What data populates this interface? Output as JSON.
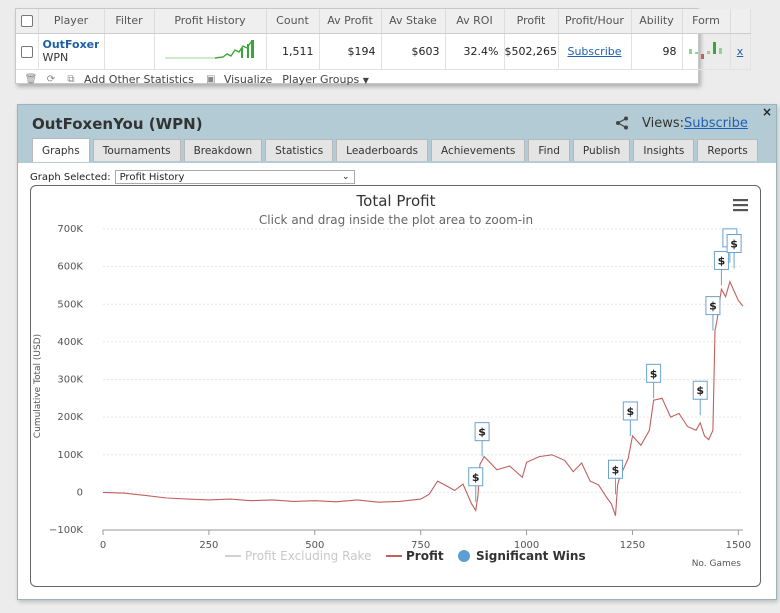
{
  "stats_table": {
    "headers": [
      "Player",
      "Filter",
      "Profit History",
      "Count",
      "Av Profit",
      "Av Stake",
      "Av ROI",
      "Profit",
      "Profit/Hour",
      "Ability",
      "Form"
    ],
    "row": {
      "player_name": "OutFoxenYou",
      "player_network": "WPN",
      "count": "1,511",
      "av_profit": "$194",
      "av_stake": "$603",
      "av_roi": "32.4%",
      "profit": "$502,265",
      "profit_hour": "Subscribe",
      "ability": "98",
      "remove": "x"
    },
    "spark_color": "#3aa63a",
    "toolbar": {
      "add_stats": "Add Other Statistics",
      "visualize": "Visualize",
      "player_groups": "Player Groups"
    }
  },
  "panel": {
    "title": "OutFoxenYou (WPN)",
    "views_label": "Views:",
    "views_link": "Subscribe",
    "close": "×",
    "tabs": [
      "Graphs",
      "Tournaments",
      "Breakdown",
      "Statistics",
      "Leaderboards",
      "Achievements",
      "Find",
      "Publish",
      "Insights",
      "Reports"
    ],
    "active_tab": 0,
    "graph_selected_label": "Graph Selected:",
    "graph_selected_value": "Profit History"
  },
  "chart_data": {
    "type": "line",
    "title": "Total Profit",
    "subtitle": "Click and drag inside the plot area to zoom-in",
    "ylabel": "Cumulative Total (USD)",
    "xlabel": "No. Games",
    "xlim": [
      0,
      1511
    ],
    "ylim": [
      -100000,
      700000
    ],
    "x_ticks": [
      0,
      250,
      500,
      750,
      1000,
      1250,
      1500
    ],
    "y_ticks": [
      -100000,
      0,
      100000,
      200000,
      300000,
      400000,
      500000,
      600000,
      700000
    ],
    "y_tick_labels": [
      "−100K",
      "0",
      "100K",
      "200K",
      "300K",
      "400K",
      "500K",
      "600K",
      "700K"
    ],
    "grid": true,
    "legend": [
      "Profit Excluding Rake",
      "Profit",
      "Significant Wins"
    ],
    "legend_position": "bottom",
    "line_color": "#c0605f",
    "marker_color": "#5a9fd4",
    "series": [
      {
        "name": "Profit",
        "x": [
          0,
          50,
          100,
          150,
          200,
          250,
          300,
          350,
          400,
          450,
          500,
          550,
          600,
          650,
          700,
          750,
          770,
          790,
          810,
          830,
          850,
          870,
          880,
          885,
          890,
          900,
          930,
          960,
          990,
          1000,
          1030,
          1060,
          1090,
          1110,
          1130,
          1150,
          1170,
          1190,
          1200,
          1210,
          1215,
          1220,
          1240,
          1250,
          1270,
          1290,
          1300,
          1320,
          1340,
          1360,
          1380,
          1400,
          1410,
          1420,
          1430,
          1440,
          1445,
          1450,
          1460,
          1470,
          1480,
          1490,
          1500,
          1511
        ],
        "y": [
          0,
          -2000,
          -8000,
          -15000,
          -18000,
          -20000,
          -18000,
          -22000,
          -20000,
          -24000,
          -22000,
          -25000,
          -20000,
          -26000,
          -24000,
          -18000,
          -5000,
          30000,
          18000,
          5000,
          22000,
          -30000,
          -48000,
          -10000,
          75000,
          95000,
          60000,
          70000,
          40000,
          80000,
          95000,
          100000,
          85000,
          55000,
          78000,
          30000,
          20000,
          -15000,
          -30000,
          -62000,
          20000,
          40000,
          90000,
          150000,
          125000,
          165000,
          245000,
          250000,
          200000,
          210000,
          175000,
          165000,
          185000,
          150000,
          140000,
          165000,
          430000,
          460000,
          540000,
          520000,
          560000,
          535000,
          510000,
          495000
        ]
      }
    ],
    "significant_wins": [
      {
        "x": 880,
        "y": -25000,
        "label": "$"
      },
      {
        "x": 895,
        "y": 95000,
        "label": "$"
      },
      {
        "x": 1210,
        "y": -5000,
        "label": "$"
      },
      {
        "x": 1245,
        "y": 150000,
        "label": "$"
      },
      {
        "x": 1300,
        "y": 250000,
        "label": "$"
      },
      {
        "x": 1410,
        "y": 205000,
        "label": "$"
      },
      {
        "x": 1440,
        "y": 430000,
        "label": "$"
      },
      {
        "x": 1460,
        "y": 550000,
        "label": "$"
      },
      {
        "x": 1480,
        "y": 610000,
        "label": "$"
      },
      {
        "x": 1490,
        "y": 595000,
        "label": "$"
      }
    ]
  }
}
